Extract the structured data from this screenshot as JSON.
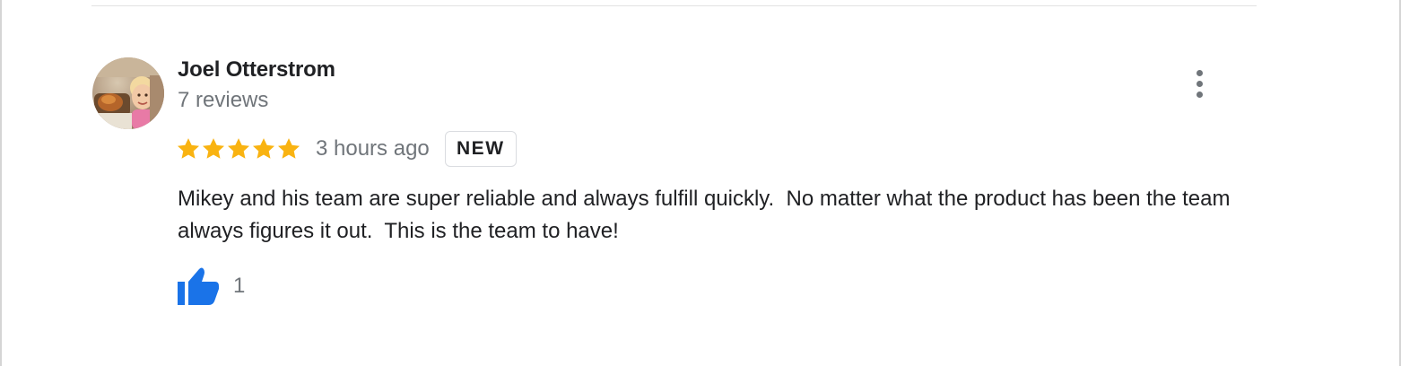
{
  "review": {
    "reviewer_name": "Joel Otterstrom",
    "review_count": "7 reviews",
    "rating": 5,
    "rating_max": 5,
    "time_ago": "3 hours ago",
    "badge": "NEW",
    "text": "Mikey and his team are super reliable and always fulfill quickly.  No matter what the product has been the team always figures it out.  This is the team to have!",
    "like_count": "1"
  },
  "icons": {
    "more": "more-vert-icon",
    "star": "star-icon",
    "like": "thumb-up-icon"
  },
  "colors": {
    "star": "#f9b311",
    "like": "#1a73e8",
    "secondary_text": "#70757a",
    "primary_text": "#202124"
  }
}
